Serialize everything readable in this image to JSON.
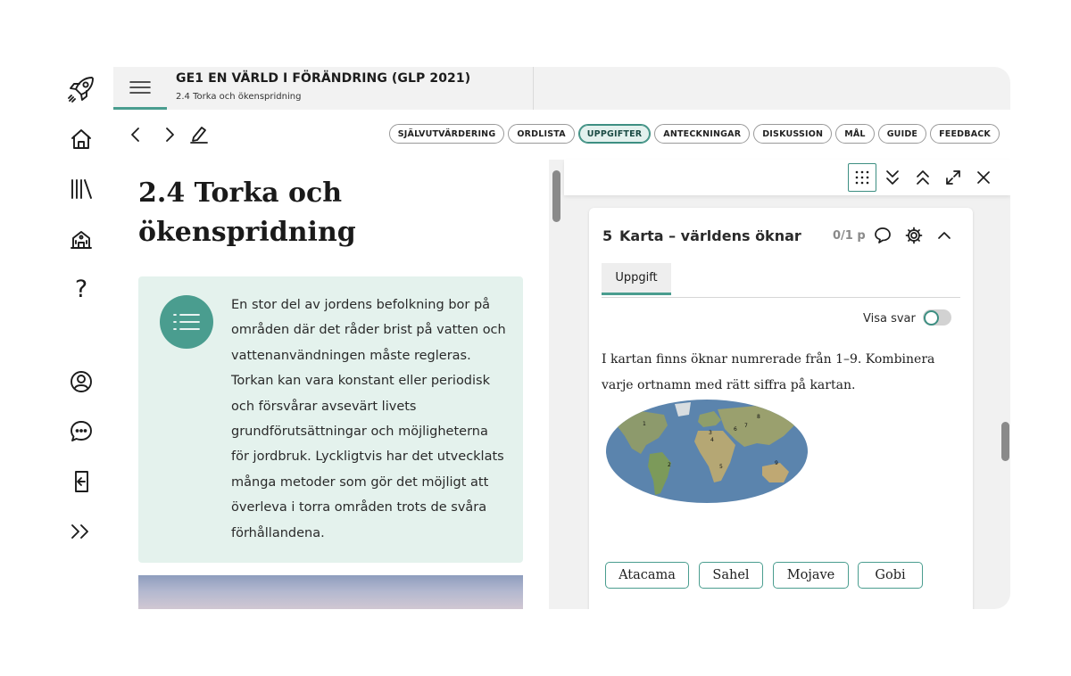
{
  "rail": {
    "icons": [
      "rocket-icon",
      "home-icon",
      "library-icon",
      "school-icon",
      "help-icon",
      "account-icon",
      "chat-icon",
      "logout-icon",
      "expand-icon"
    ],
    "help_glyph": "?"
  },
  "header": {
    "book_title": "GE1 EN VÄRLD I FÖRÄNDRING (GLP 2021)",
    "chapter": "2.4 Torka och ökenspridning"
  },
  "navbar": {
    "pills": [
      {
        "label": "SJÄLVUTVÄRDERING",
        "active": false
      },
      {
        "label": "ORDLISTA",
        "active": false
      },
      {
        "label": "UPPGIFTER",
        "active": true
      },
      {
        "label": "ANTECKNINGAR",
        "active": false
      },
      {
        "label": "DISKUSSION",
        "active": false
      },
      {
        "label": "MÅL",
        "active": false
      },
      {
        "label": "GUIDE",
        "active": false
      },
      {
        "label": "FEEDBACK",
        "active": false
      }
    ]
  },
  "article": {
    "title": "2.4 Torka och ökenspridning",
    "intro": "En stor del av jordens befolkning bor på områden där det råder brist på vatten och vattenanvändningen måste regleras. Torkan kan vara konstant eller periodisk och försvårar avsevärt livets grundförutsättningar och möjligheterna för jordbruk. Lyckligtvis har det utvecklats många metoder som gör det möjligt att överleva i torra områden trots de svåra förhållandena."
  },
  "task": {
    "number": "5",
    "title": "Karta – världens öknar",
    "points": "0/1 p",
    "tab": "Uppgift",
    "show_answer_label": "Visa svar",
    "show_answer_on": false,
    "instruction": "I kartan finns öknar numrerade från 1–9. Kombinera varje ortnamn med rätt siffra på kartan.",
    "map_labels": [
      "1",
      "2",
      "3",
      "4",
      "5",
      "6",
      "7",
      "8",
      "9"
    ],
    "chips": [
      "Atacama",
      "Sahel",
      "Mojave",
      "Gobi"
    ]
  },
  "colors": {
    "accent": "#4a9d8f",
    "intro_bg": "#e4f2ed",
    "active_pill_bg": "#e3f1ee"
  }
}
